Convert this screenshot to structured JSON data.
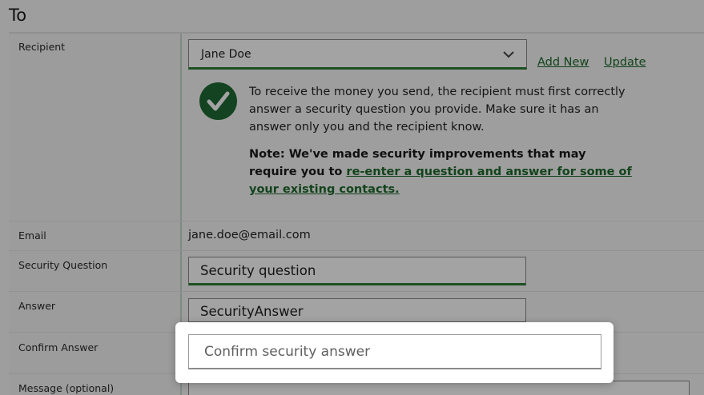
{
  "section_title": "To",
  "recipient": {
    "label": "Recipient",
    "selected": "Jane Doe",
    "add_new": "Add New",
    "update": "Update"
  },
  "info": {
    "text": "To receive the money you send, the recipient must first correctly answer a security question you provide. Make sure it has an answer only you and the recipient know.",
    "note_prefix": "Note: We've made security improvements that may require you to ",
    "note_link": "re-enter a question and answer for some of your existing contacts."
  },
  "email": {
    "label": "Email",
    "value": "jane.doe@email.com"
  },
  "security_question": {
    "label": "Security Question",
    "value": "Security question"
  },
  "answer": {
    "label": "Answer",
    "value": "SecurityAnswer"
  },
  "confirm_answer": {
    "label": "Confirm Answer",
    "placeholder": "Confirm security answer"
  },
  "message": {
    "label": "Message (optional)",
    "value": ""
  },
  "colors": {
    "accent": "#2e7d32",
    "link": "#1d6a2b",
    "badge": "#1f6a33"
  },
  "icons": {
    "dropdown": "chevron-down-icon",
    "check": "checkmark-icon"
  }
}
